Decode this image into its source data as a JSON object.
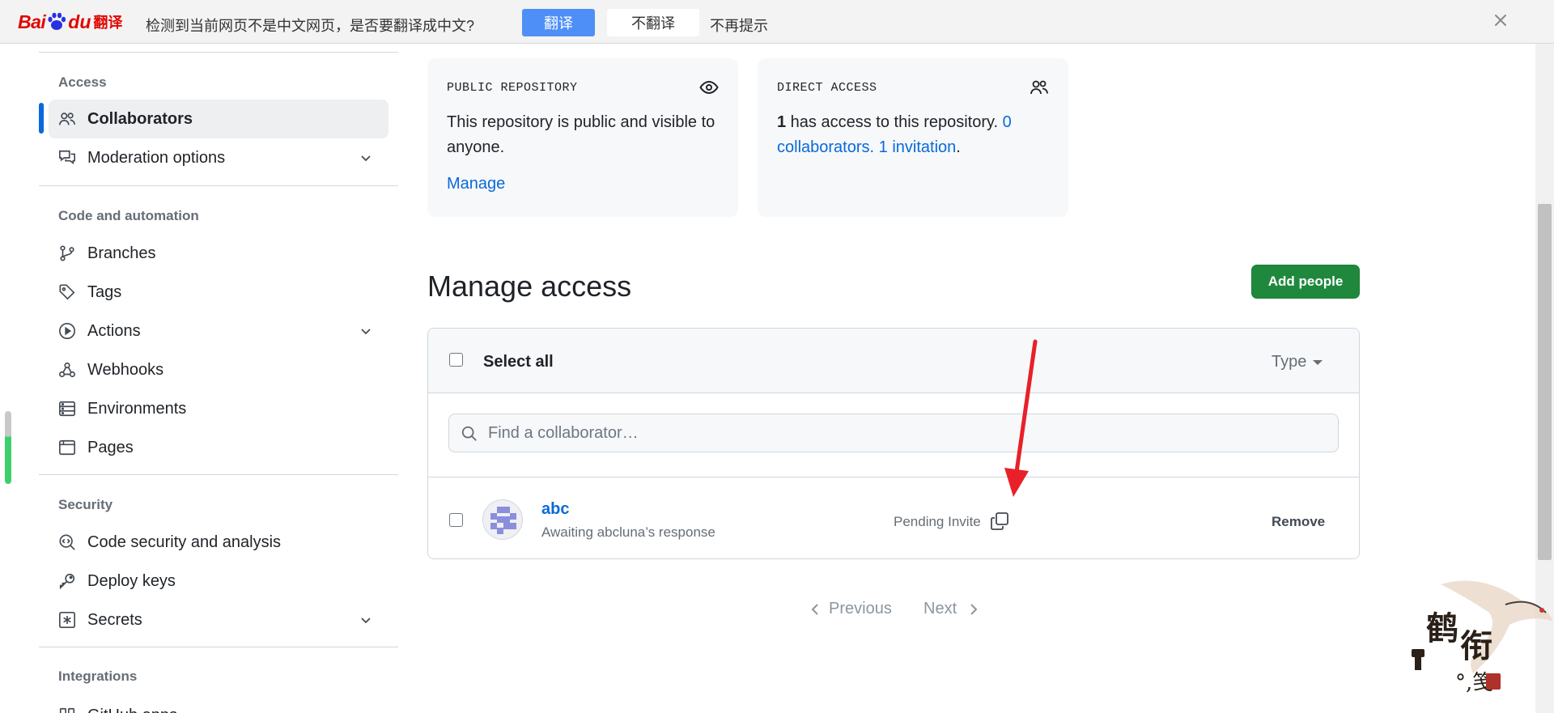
{
  "translate_bar": {
    "logo_bai": "Bai",
    "logo_du": "du",
    "logo_fanyi": "翻译",
    "message": "检测到当前网页不是中文网页，是否要翻译成中文?",
    "translate_button": "翻译",
    "dont_translate_button": "不翻译",
    "never_remind": "不再提示",
    "close_icon": "close-icon"
  },
  "sidebar": {
    "sections": [
      {
        "heading": "Access",
        "items": [
          {
            "label": "Collaborators",
            "icon": "people-icon",
            "active": true
          },
          {
            "label": "Moderation options",
            "icon": "comment-discussion-icon",
            "expandable": true
          }
        ]
      },
      {
        "heading": "Code and automation",
        "items": [
          {
            "label": "Branches",
            "icon": "git-branch-icon"
          },
          {
            "label": "Tags",
            "icon": "tag-icon"
          },
          {
            "label": "Actions",
            "icon": "play-icon",
            "expandable": true
          },
          {
            "label": "Webhooks",
            "icon": "webhook-icon"
          },
          {
            "label": "Environments",
            "icon": "server-icon"
          },
          {
            "label": "Pages",
            "icon": "browser-icon"
          }
        ]
      },
      {
        "heading": "Security",
        "items": [
          {
            "label": "Code security and analysis",
            "icon": "codescan-icon"
          },
          {
            "label": "Deploy keys",
            "icon": "key-icon"
          },
          {
            "label": "Secrets",
            "icon": "asterisk-icon",
            "expandable": true
          }
        ]
      },
      {
        "heading": "Integrations",
        "items": [
          {
            "label": "GitHub apps",
            "icon": "apps-icon"
          }
        ]
      }
    ]
  },
  "cards": {
    "public": {
      "kind": "PUBLIC REPOSITORY",
      "icon": "eye-icon",
      "text": "This repository is public and visible to anyone.",
      "link": "Manage"
    },
    "direct": {
      "kind": "DIRECT ACCESS",
      "icon": "people-icon",
      "count": "1",
      "text_mid": " has access to this repository. ",
      "collaborators_link": "0 collaborators",
      "sep": ". ",
      "invitation_link": "1 invitation",
      "end": "."
    }
  },
  "manage": {
    "title": "Manage access",
    "add_button": "Add people",
    "select_all": "Select all",
    "type_filter": "Type",
    "search_placeholder": "Find a collaborator…",
    "rows": [
      {
        "name": "abc",
        "subtitle": "Awaiting abcluna’s response",
        "status": "Pending Invite",
        "action": "Remove"
      }
    ]
  },
  "pagination": {
    "previous": "Previous",
    "next": "Next"
  },
  "colors": {
    "accent": "#0969da",
    "primary_button": "#1f883d",
    "baidu_red": "#e10601",
    "translate_blue": "#4e8ff7",
    "annotation_arrow": "#e8202a"
  }
}
